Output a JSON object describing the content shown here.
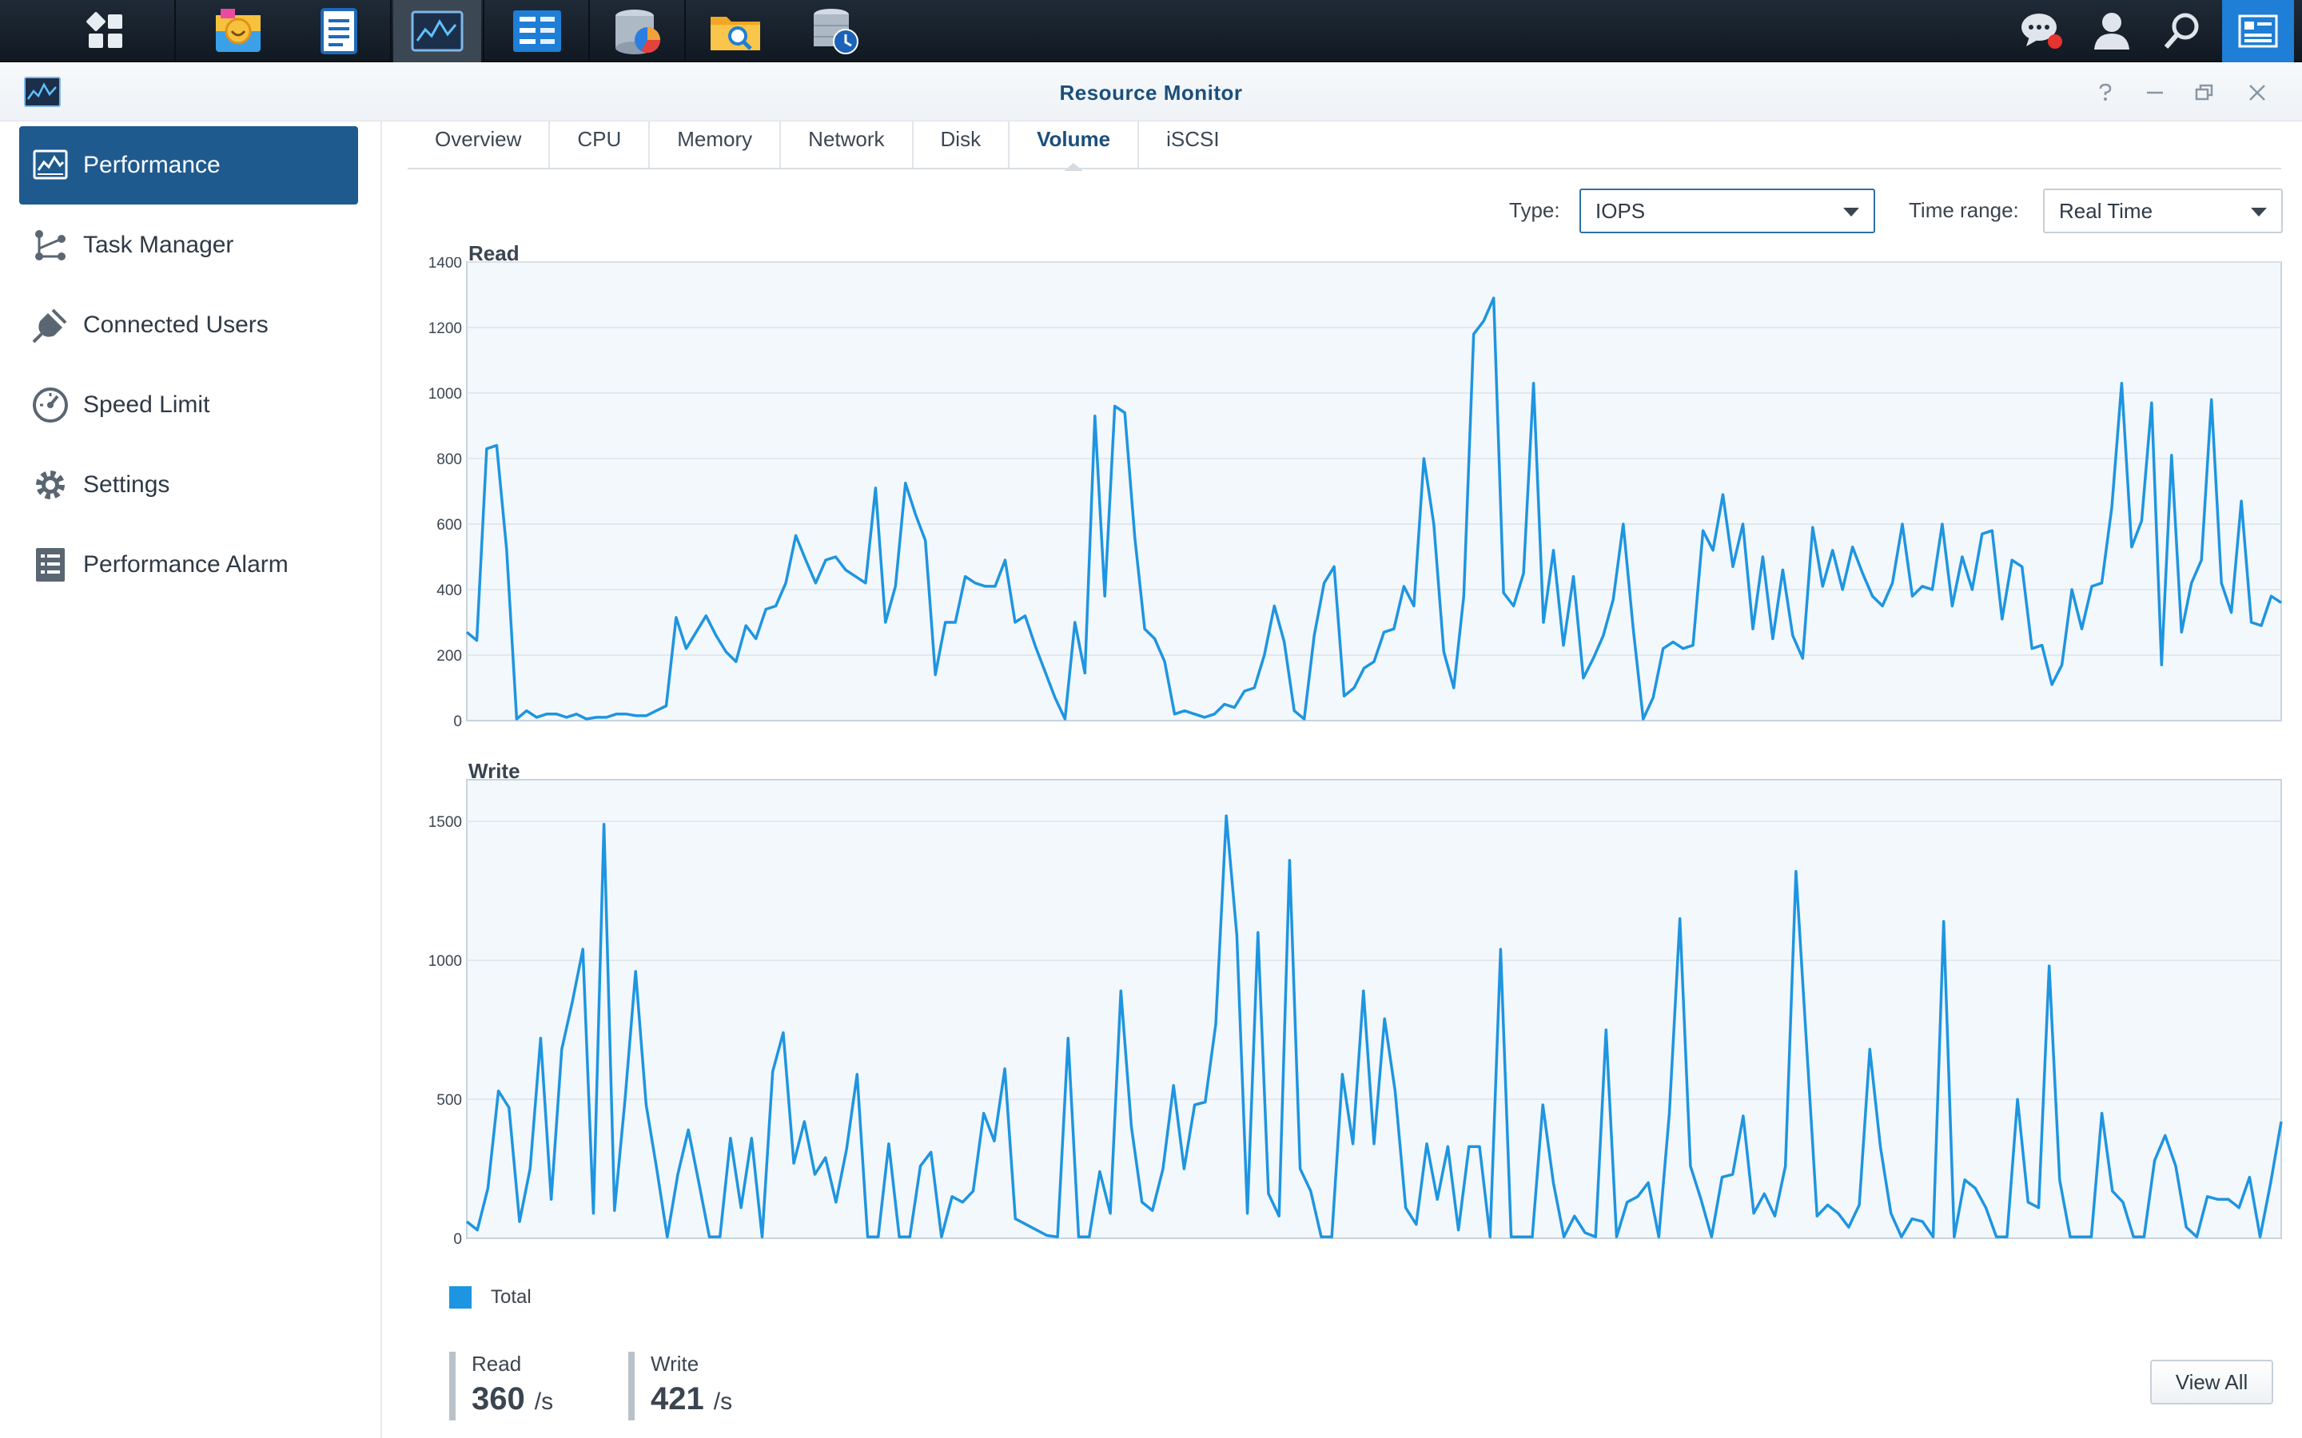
{
  "window": {
    "title": "Resource Monitor"
  },
  "taskbar": {
    "apps": [
      {
        "name": "main-menu-icon"
      },
      {
        "name": "package-center-icon"
      },
      {
        "name": "log-center-icon"
      },
      {
        "name": "resource-monitor-icon"
      },
      {
        "name": "control-panel-icon"
      },
      {
        "name": "storage-analyzer-icon"
      },
      {
        "name": "file-station-icon"
      },
      {
        "name": "backup-icon"
      }
    ],
    "right": [
      {
        "name": "notifications-icon"
      },
      {
        "name": "user-icon"
      },
      {
        "name": "search-icon"
      },
      {
        "name": "widgets-icon"
      }
    ]
  },
  "sidebar": {
    "items": [
      {
        "label": "Performance",
        "icon": "performance-icon",
        "active": true
      },
      {
        "label": "Task Manager",
        "icon": "task-manager-icon"
      },
      {
        "label": "Connected Users",
        "icon": "connected-users-icon"
      },
      {
        "label": "Speed Limit",
        "icon": "speed-limit-icon"
      },
      {
        "label": "Settings",
        "icon": "settings-icon"
      },
      {
        "label": "Performance Alarm",
        "icon": "performance-alarm-icon"
      }
    ]
  },
  "tabs": [
    "Overview",
    "CPU",
    "Memory",
    "Network",
    "Disk",
    "Volume",
    "iSCSI"
  ],
  "active_tab": "Volume",
  "controls": {
    "type_label": "Type:",
    "type_value": "IOPS",
    "range_label": "Time range:",
    "range_value": "Real Time"
  },
  "legend": {
    "label": "Total",
    "color": "#1e95e0"
  },
  "stats": {
    "read_label": "Read",
    "read_value": "360",
    "read_unit": "/s",
    "write_label": "Write",
    "write_value": "421",
    "write_unit": "/s"
  },
  "buttons": {
    "view_all": "View All"
  },
  "colors": {
    "accent": "#1f5a8f",
    "series": "#1e95e0",
    "plot_bg": "#f3f8fd"
  },
  "chart_data": [
    {
      "type": "line",
      "title": "Read",
      "ylim": [
        0,
        1400
      ],
      "yticks": [
        0,
        200,
        400,
        600,
        800,
        1000,
        1200,
        1400
      ],
      "grid": true,
      "series": [
        {
          "name": "Total",
          "values": [
            270,
            245,
            830,
            840,
            520,
            5,
            30,
            10,
            20,
            20,
            10,
            20,
            5,
            10,
            10,
            20,
            20,
            15,
            15,
            30,
            45,
            315,
            220,
            270,
            320,
            260,
            210,
            180,
            290,
            250,
            340,
            350,
            420,
            565,
            490,
            420,
            490,
            500,
            460,
            440,
            420,
            710,
            300,
            410,
            725,
            630,
            550,
            140,
            300,
            300,
            440,
            420,
            410,
            410,
            490,
            300,
            320,
            230,
            150,
            70,
            5,
            300,
            145,
            930,
            380,
            960,
            940,
            560,
            280,
            250,
            180,
            20,
            30,
            20,
            10,
            20,
            50,
            40,
            90,
            100,
            200,
            350,
            240,
            30,
            5,
            260,
            420,
            470,
            75,
            100,
            160,
            180,
            270,
            280,
            410,
            350,
            800,
            600,
            210,
            100,
            380,
            1180,
            1220,
            1290,
            390,
            350,
            450,
            1030,
            300,
            520,
            230,
            440,
            130,
            190,
            260,
            370,
            600,
            280,
            5,
            70,
            220,
            240,
            220,
            230,
            580,
            520,
            690,
            470,
            600,
            280,
            500,
            250,
            460,
            260,
            190,
            590,
            410,
            520,
            400,
            530,
            450,
            380,
            350,
            420,
            600,
            380,
            410,
            400,
            600,
            350,
            500,
            400,
            570,
            580,
            310,
            490,
            470,
            220,
            230,
            110,
            170,
            400,
            280,
            410,
            420,
            650,
            1030,
            530,
            610,
            970,
            170,
            810,
            270,
            420,
            490,
            980,
            420,
            330,
            670,
            300,
            290,
            380,
            360
          ]
        }
      ]
    },
    {
      "type": "line",
      "title": "Write",
      "ylim": [
        0,
        1650
      ],
      "yticks": [
        0,
        500,
        1000,
        1500
      ],
      "grid": true,
      "series": [
        {
          "name": "Total",
          "values": [
            60,
            30,
            180,
            530,
            470,
            60,
            250,
            720,
            140,
            680,
            850,
            1040,
            90,
            1490,
            100,
            500,
            960,
            480,
            250,
            5,
            230,
            390,
            200,
            5,
            5,
            360,
            110,
            360,
            5,
            600,
            740,
            270,
            420,
            230,
            290,
            130,
            320,
            590,
            5,
            5,
            340,
            5,
            5,
            260,
            310,
            5,
            150,
            130,
            170,
            450,
            350,
            610,
            70,
            50,
            30,
            10,
            5,
            720,
            5,
            5,
            240,
            90,
            890,
            400,
            130,
            100,
            250,
            550,
            250,
            480,
            490,
            770,
            1520,
            1090,
            90,
            1100,
            160,
            80,
            1360,
            250,
            170,
            5,
            5,
            590,
            340,
            890,
            340,
            790,
            530,
            110,
            50,
            340,
            140,
            330,
            30,
            330,
            330,
            5,
            1040,
            5,
            5,
            5,
            480,
            200,
            5,
            80,
            20,
            5,
            750,
            5,
            130,
            150,
            200,
            5,
            450,
            1150,
            260,
            140,
            5,
            220,
            230,
            440,
            90,
            160,
            80,
            260,
            1320,
            700,
            80,
            120,
            90,
            40,
            120,
            680,
            330,
            90,
            5,
            70,
            60,
            5,
            1140,
            5,
            210,
            180,
            110,
            5,
            5,
            500,
            130,
            110,
            980,
            210,
            5,
            5,
            5,
            450,
            170,
            130,
            5,
            5,
            280,
            370,
            260,
            40,
            5,
            150,
            140,
            140,
            110,
            220,
            5,
            200,
            420
          ]
        }
      ]
    }
  ]
}
